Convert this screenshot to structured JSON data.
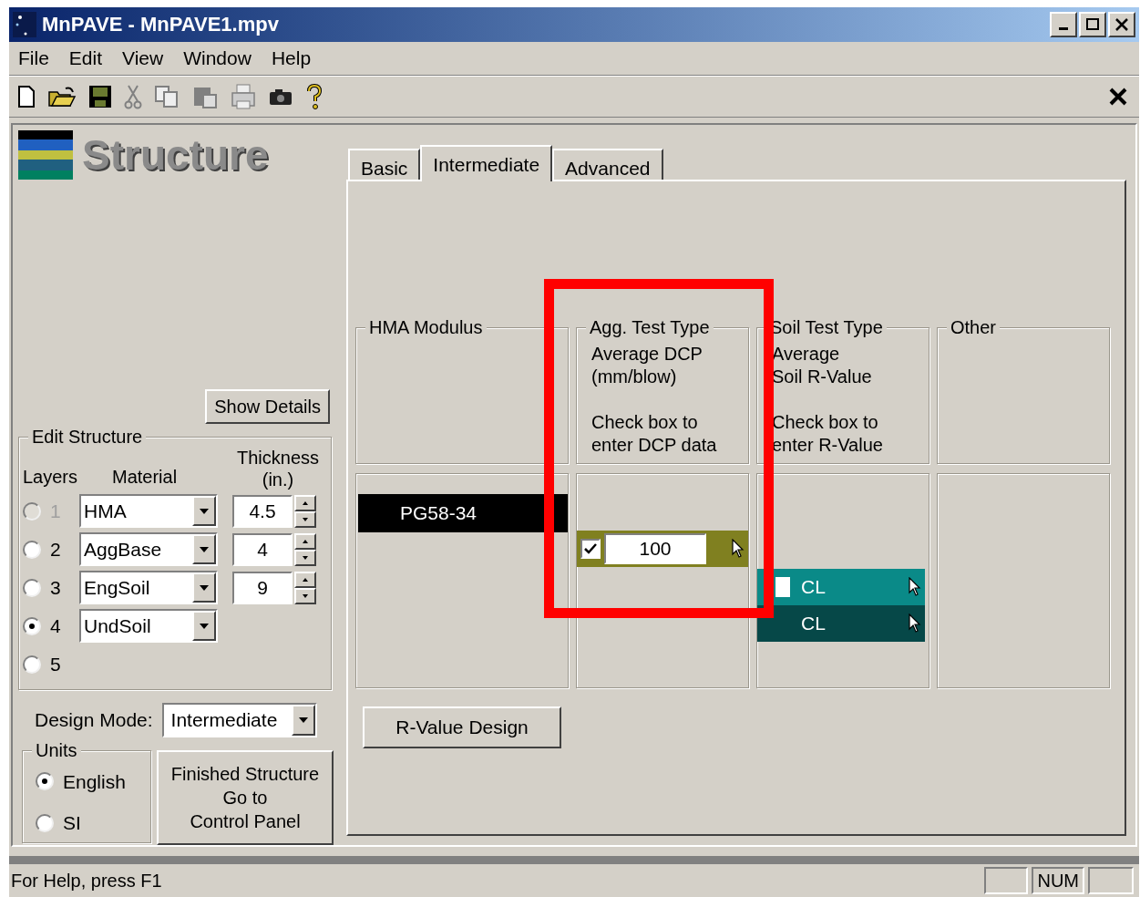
{
  "window": {
    "title": "MnPAVE - MnPAVE1.mpv"
  },
  "menu": [
    "File",
    "Edit",
    "View",
    "Window",
    "Help"
  ],
  "heading": "Structure",
  "show_details": "Show Details",
  "edit_structure": {
    "title": "Edit Structure",
    "headers": {
      "layers": "Layers",
      "material": "Material",
      "thickness": "Thickness",
      "unit": "(in.)"
    },
    "layers": [
      {
        "number": "1",
        "selected": false,
        "disabled": true,
        "material": "HMA",
        "thickness": "4.5"
      },
      {
        "number": "2",
        "selected": false,
        "disabled": false,
        "material": "AggBase",
        "thickness": "4"
      },
      {
        "number": "3",
        "selected": false,
        "disabled": false,
        "material": "EngSoil",
        "thickness": "9"
      },
      {
        "number": "4",
        "selected": true,
        "disabled": false,
        "material": "UndSoil"
      },
      {
        "number": "5",
        "selected": false,
        "disabled": false
      }
    ]
  },
  "design_mode": {
    "label": "Design Mode:",
    "value": "Intermediate"
  },
  "units": {
    "title": "Units",
    "options": [
      {
        "label": "English",
        "selected": true
      },
      {
        "label": "SI",
        "selected": false
      }
    ]
  },
  "finish_button": [
    "Finished Structure",
    "Go to",
    "Control Panel"
  ],
  "tabs": [
    {
      "label": "Basic",
      "selected": false
    },
    {
      "label": "Intermediate",
      "selected": true
    },
    {
      "label": "Advanced",
      "selected": false
    }
  ],
  "groups": [
    {
      "title": "HMA Modulus"
    },
    {
      "title": "Agg. Test Type",
      "paragraphs": [
        [
          "Average DCP",
          "(mm/blow)"
        ],
        [
          "Check box to",
          "enter DCP data"
        ]
      ]
    },
    {
      "title": "Soil Test Type",
      "paragraphs": [
        [
          "Average",
          "Soil R-Value"
        ],
        [
          "Check box to",
          "enter R-Value"
        ]
      ]
    },
    {
      "title": "Other"
    }
  ],
  "hma_binder": "PG58-34",
  "agg_entry": {
    "checked": true,
    "value": "100"
  },
  "soil_rows": [
    {
      "kind": "checkbox",
      "label": "CL",
      "checked": false
    },
    {
      "kind": "plain",
      "label": "CL"
    }
  ],
  "rvalue_button": "R-Value Design",
  "status_bar": {
    "text": "For Help, press F1",
    "panels": [
      "NUM"
    ]
  }
}
